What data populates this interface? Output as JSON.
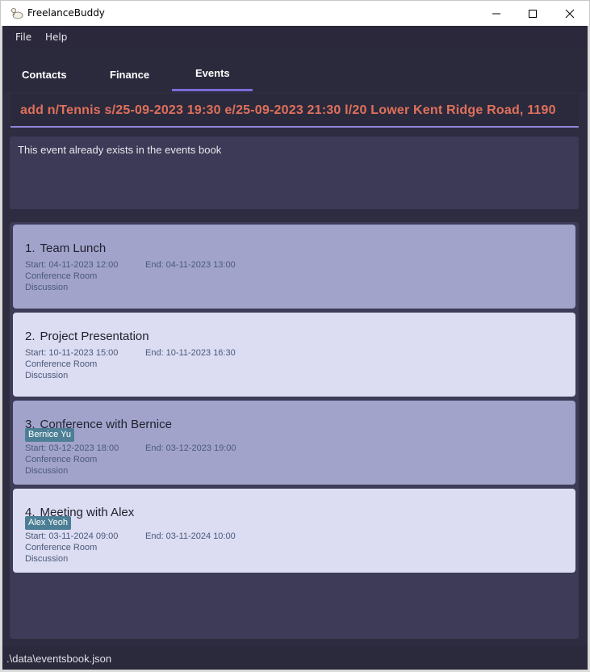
{
  "window": {
    "title": "FreelanceBuddy"
  },
  "menu": {
    "file": "File",
    "help": "Help"
  },
  "tabs": [
    {
      "label": "Contacts"
    },
    {
      "label": "Finance"
    },
    {
      "label": "Events",
      "selected": true
    }
  ],
  "command": {
    "value": "add n/Tennis s/25-09-2023 19:30 e/25-09-2023 21:30 l/20 Lower Kent Ridge Road, 1190"
  },
  "result": {
    "message": "This event already exists in the events book"
  },
  "events": [
    {
      "index": "1.",
      "name": "Team Lunch",
      "start": "Start: 04-11-2023 12:00",
      "end": "End: 04-11-2023 13:00",
      "location": "Conference Room",
      "description": "Discussion",
      "tag": ""
    },
    {
      "index": "2.",
      "name": "Project Presentation",
      "start": "Start: 10-11-2023 15:00",
      "end": "End: 10-11-2023 16:30",
      "location": "Conference Room",
      "description": "Discussion",
      "tag": ""
    },
    {
      "index": "3.",
      "name": "Conference with Bernice",
      "start": "Start: 03-12-2023 18:00",
      "end": "End: 03-12-2023 19:00",
      "location": "Conference Room",
      "description": "Discussion",
      "tag": "Bernice Yu"
    },
    {
      "index": "4.",
      "name": "Meeting with Alex",
      "start": "Start: 03-11-2024 09:00",
      "end": "End: 03-11-2024 10:00",
      "location": "Conference Room",
      "description": "Discussion",
      "tag": "Alex Yeoh"
    }
  ],
  "status": {
    "path": ".\\data\\eventsbook.json"
  },
  "colors": {
    "accent": "#7b6bd6",
    "command_text": "#e0705a",
    "tag": "#4c7f95"
  }
}
